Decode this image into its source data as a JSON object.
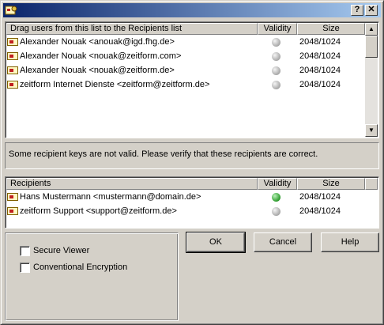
{
  "titlebar": {
    "help_label": "?",
    "close_label": "✕"
  },
  "keylist": {
    "columns": {
      "user": "Drag users from this list to the Recipients list",
      "validity": "Validity",
      "size": "Size"
    },
    "rows": [
      {
        "user": "Alexander Nouak <anouak@igd.fhg.de>",
        "size": "2048/1024"
      },
      {
        "user": "Alexander Nouak <nouak@zeitform.com>",
        "size": "2048/1024"
      },
      {
        "user": "Alexander Nouak <nouak@zeitform.de>",
        "size": "2048/1024"
      },
      {
        "user": "zeitform Internet Dienste <zeitform@zeitform.de>",
        "size": "2048/1024"
      }
    ]
  },
  "message": "Some recipient keys are not valid. Please verify that these recipients are correct.",
  "recipients": {
    "columns": {
      "user": "Recipients",
      "validity": "Validity",
      "size": "Size"
    },
    "rows": [
      {
        "user": "Hans Mustermann <mustermann@domain.de>",
        "size": "2048/1024"
      },
      {
        "user": "zeitform Support <support@zeitform.de>",
        "size": "2048/1024"
      }
    ]
  },
  "options": {
    "secure_viewer": "Secure Viewer",
    "conventional_encryption": "Conventional Encryption"
  },
  "buttons": {
    "ok": "OK",
    "cancel": "Cancel",
    "help": "Help"
  }
}
